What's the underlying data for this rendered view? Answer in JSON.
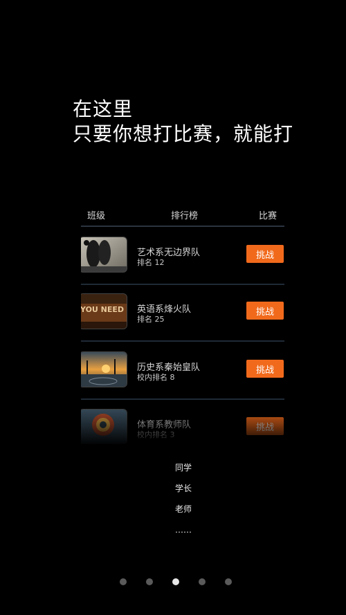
{
  "headline": {
    "line1": "在这里",
    "line2": "只要你想打比赛，就能打"
  },
  "tabs": [
    {
      "label": "班级"
    },
    {
      "label": "排行榜"
    },
    {
      "label": "比赛"
    }
  ],
  "teams": [
    {
      "name": "艺术系无边界队",
      "rank": "排名 12",
      "button": "挑战"
    },
    {
      "name": "英语系烽火队",
      "rank": "排名 25",
      "button": "挑战"
    },
    {
      "name": "历史系秦始皇队",
      "rank": "校内排名 8",
      "button": "挑战"
    },
    {
      "name": "体育系教师队",
      "rank": "校内排名 3",
      "button": "挑战"
    }
  ],
  "thumb_texts": {
    "english": "YOU NEED A COURT"
  },
  "roles": [
    "同学",
    "学长",
    "老师",
    "……"
  ],
  "pager": {
    "count": 5,
    "active_index": 2
  },
  "colors": {
    "accent": "#f16a1c",
    "background": "#000000"
  }
}
